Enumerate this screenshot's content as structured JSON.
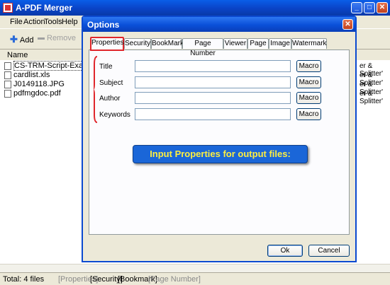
{
  "app": {
    "title": "A-PDF Merger"
  },
  "menu": [
    "File",
    "Action",
    "Tools",
    "Help"
  ],
  "toolbar": {
    "add": "Add",
    "remove": "Remove"
  },
  "list": {
    "column_name": "Name",
    "files": [
      "CS-TRM-Script-Example.txt",
      "cardlist.xls",
      "J0149118.JPG",
      "pdfmgdoc.pdf"
    ],
    "right_text": "er & Splitter'"
  },
  "status": {
    "total": "Total: 4 files",
    "sections": [
      "[Properties]",
      "[Security]",
      "[Bookmark]",
      "[Page Number]"
    ]
  },
  "dialog": {
    "title": "Options",
    "tabs": [
      "Properties",
      "Security",
      "BookMark",
      "Page Number",
      "Viewer",
      "Page",
      "Image",
      "Watermark"
    ],
    "fields": [
      {
        "label": "Title",
        "value": ""
      },
      {
        "label": "Subject",
        "value": ""
      },
      {
        "label": "Author",
        "value": ""
      },
      {
        "label": "Keywords",
        "value": ""
      }
    ],
    "macro_label": "Macro",
    "banner": "Input Properties for output files:",
    "ok": "Ok",
    "cancel": "Cancel"
  },
  "colors": {
    "titlebar": "#0a4fd8",
    "banner_bg": "#1a66d8",
    "banner_text": "#ffef3f",
    "highlight": "#e0262b"
  }
}
